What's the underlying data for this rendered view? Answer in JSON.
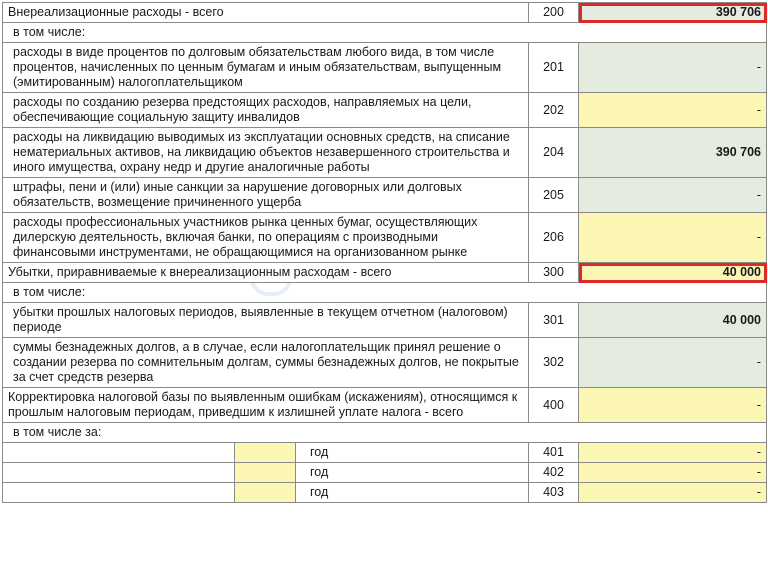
{
  "rows": {
    "r200": {
      "label": "Внереализационные расходы - всего",
      "code": "200",
      "value": "390 706"
    },
    "r200_sub": {
      "label": "в том числе:"
    },
    "r201": {
      "label": "расходы в виде процентов по долговым обязательствам любого вида, в том числе процентов, начисленных по ценным бумагам и иным обязательствам, выпущенным (эмитированным) налогоплательщиком",
      "code": "201",
      "value": "-"
    },
    "r202": {
      "label": "расходы по созданию резерва предстоящих расходов, направляемых на цели, обеспечивающие социальную защиту инвалидов",
      "code": "202",
      "value": "-"
    },
    "r204": {
      "label": "расходы на ликвидацию выводимых из эксплуатации основных средств, на списание нематериальных активов, на ликвидацию объектов незавершенного строительства и иного имущества, охрану недр и другие аналогичные работы",
      "code": "204",
      "value": "390 706"
    },
    "r205": {
      "label": "штрафы, пени и (или) иные санкции за нарушение договорных или долговых обязательств, возмещение причиненного ущерба",
      "code": "205",
      "value": "-"
    },
    "r206": {
      "label": "расходы профессиональных участников рынка ценных бумаг, осуществляющих дилерскую деятельность, включая банки, по операциям с производными финансовыми инструментами, не обращающимися на организованном рынке",
      "code": "206",
      "value": "-"
    },
    "r300": {
      "label": "Убытки, приравниваемые к внереализационным расходам - всего",
      "code": "300",
      "value": "40 000"
    },
    "r300_sub": {
      "label": "в том числе:"
    },
    "r301": {
      "label": "убытки прошлых налоговых периодов, выявленные в текущем отчетном (налоговом) периоде",
      "code": "301",
      "value": "40 000"
    },
    "r302": {
      "label": "суммы безнадежных долгов, а в случае, если налогоплательщик принял решение о создании резерва по сомнительным долгам, суммы безнадежных долгов, не покрытые за счет средств резерва",
      "code": "302",
      "value": "-"
    },
    "r400": {
      "label": "Корректировка налоговой базы по выявленным ошибкам (искажениям), относящимся к прошлым налоговым периодам, приведшим к излишней уплате налога - всего",
      "code": "400",
      "value": "-"
    },
    "r400_sub": {
      "label": "в том числе за:"
    },
    "r401": {
      "year_label": "год",
      "code": "401",
      "value": "-"
    },
    "r402": {
      "year_label": "год",
      "code": "402",
      "value": "-"
    },
    "r403": {
      "year_label": "год",
      "code": "403",
      "value": "-"
    }
  },
  "colors": {
    "green_cell": "#e3ecde",
    "yellow_cell": "#fbf6b4",
    "highlight": "#e02828"
  }
}
